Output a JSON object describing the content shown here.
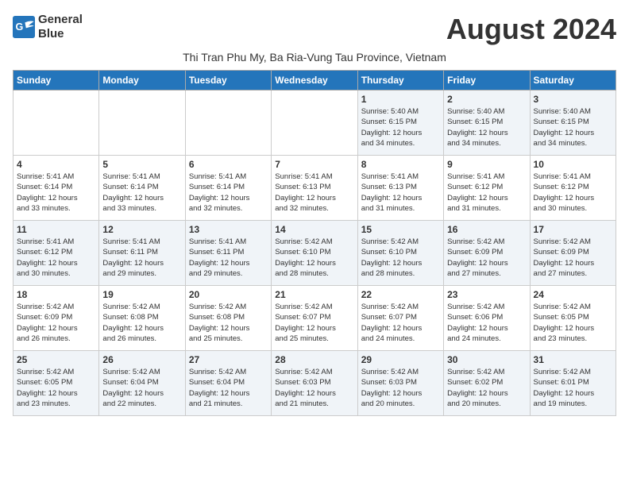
{
  "logo": {
    "line1": "General",
    "line2": "Blue"
  },
  "title": "August 2024",
  "subtitle": "Thi Tran Phu My, Ba Ria-Vung Tau Province, Vietnam",
  "days_of_week": [
    "Sunday",
    "Monday",
    "Tuesday",
    "Wednesday",
    "Thursday",
    "Friday",
    "Saturday"
  ],
  "weeks": [
    [
      {
        "day": "",
        "info": ""
      },
      {
        "day": "",
        "info": ""
      },
      {
        "day": "",
        "info": ""
      },
      {
        "day": "",
        "info": ""
      },
      {
        "day": "1",
        "info": "Sunrise: 5:40 AM\nSunset: 6:15 PM\nDaylight: 12 hours\nand 34 minutes."
      },
      {
        "day": "2",
        "info": "Sunrise: 5:40 AM\nSunset: 6:15 PM\nDaylight: 12 hours\nand 34 minutes."
      },
      {
        "day": "3",
        "info": "Sunrise: 5:40 AM\nSunset: 6:15 PM\nDaylight: 12 hours\nand 34 minutes."
      }
    ],
    [
      {
        "day": "4",
        "info": "Sunrise: 5:41 AM\nSunset: 6:14 PM\nDaylight: 12 hours\nand 33 minutes."
      },
      {
        "day": "5",
        "info": "Sunrise: 5:41 AM\nSunset: 6:14 PM\nDaylight: 12 hours\nand 33 minutes."
      },
      {
        "day": "6",
        "info": "Sunrise: 5:41 AM\nSunset: 6:14 PM\nDaylight: 12 hours\nand 32 minutes."
      },
      {
        "day": "7",
        "info": "Sunrise: 5:41 AM\nSunset: 6:13 PM\nDaylight: 12 hours\nand 32 minutes."
      },
      {
        "day": "8",
        "info": "Sunrise: 5:41 AM\nSunset: 6:13 PM\nDaylight: 12 hours\nand 31 minutes."
      },
      {
        "day": "9",
        "info": "Sunrise: 5:41 AM\nSunset: 6:12 PM\nDaylight: 12 hours\nand 31 minutes."
      },
      {
        "day": "10",
        "info": "Sunrise: 5:41 AM\nSunset: 6:12 PM\nDaylight: 12 hours\nand 30 minutes."
      }
    ],
    [
      {
        "day": "11",
        "info": "Sunrise: 5:41 AM\nSunset: 6:12 PM\nDaylight: 12 hours\nand 30 minutes."
      },
      {
        "day": "12",
        "info": "Sunrise: 5:41 AM\nSunset: 6:11 PM\nDaylight: 12 hours\nand 29 minutes."
      },
      {
        "day": "13",
        "info": "Sunrise: 5:41 AM\nSunset: 6:11 PM\nDaylight: 12 hours\nand 29 minutes."
      },
      {
        "day": "14",
        "info": "Sunrise: 5:42 AM\nSunset: 6:10 PM\nDaylight: 12 hours\nand 28 minutes."
      },
      {
        "day": "15",
        "info": "Sunrise: 5:42 AM\nSunset: 6:10 PM\nDaylight: 12 hours\nand 28 minutes."
      },
      {
        "day": "16",
        "info": "Sunrise: 5:42 AM\nSunset: 6:09 PM\nDaylight: 12 hours\nand 27 minutes."
      },
      {
        "day": "17",
        "info": "Sunrise: 5:42 AM\nSunset: 6:09 PM\nDaylight: 12 hours\nand 27 minutes."
      }
    ],
    [
      {
        "day": "18",
        "info": "Sunrise: 5:42 AM\nSunset: 6:09 PM\nDaylight: 12 hours\nand 26 minutes."
      },
      {
        "day": "19",
        "info": "Sunrise: 5:42 AM\nSunset: 6:08 PM\nDaylight: 12 hours\nand 26 minutes."
      },
      {
        "day": "20",
        "info": "Sunrise: 5:42 AM\nSunset: 6:08 PM\nDaylight: 12 hours\nand 25 minutes."
      },
      {
        "day": "21",
        "info": "Sunrise: 5:42 AM\nSunset: 6:07 PM\nDaylight: 12 hours\nand 25 minutes."
      },
      {
        "day": "22",
        "info": "Sunrise: 5:42 AM\nSunset: 6:07 PM\nDaylight: 12 hours\nand 24 minutes."
      },
      {
        "day": "23",
        "info": "Sunrise: 5:42 AM\nSunset: 6:06 PM\nDaylight: 12 hours\nand 24 minutes."
      },
      {
        "day": "24",
        "info": "Sunrise: 5:42 AM\nSunset: 6:05 PM\nDaylight: 12 hours\nand 23 minutes."
      }
    ],
    [
      {
        "day": "25",
        "info": "Sunrise: 5:42 AM\nSunset: 6:05 PM\nDaylight: 12 hours\nand 23 minutes."
      },
      {
        "day": "26",
        "info": "Sunrise: 5:42 AM\nSunset: 6:04 PM\nDaylight: 12 hours\nand 22 minutes."
      },
      {
        "day": "27",
        "info": "Sunrise: 5:42 AM\nSunset: 6:04 PM\nDaylight: 12 hours\nand 21 minutes."
      },
      {
        "day": "28",
        "info": "Sunrise: 5:42 AM\nSunset: 6:03 PM\nDaylight: 12 hours\nand 21 minutes."
      },
      {
        "day": "29",
        "info": "Sunrise: 5:42 AM\nSunset: 6:03 PM\nDaylight: 12 hours\nand 20 minutes."
      },
      {
        "day": "30",
        "info": "Sunrise: 5:42 AM\nSunset: 6:02 PM\nDaylight: 12 hours\nand 20 minutes."
      },
      {
        "day": "31",
        "info": "Sunrise: 5:42 AM\nSunset: 6:01 PM\nDaylight: 12 hours\nand 19 minutes."
      }
    ]
  ]
}
